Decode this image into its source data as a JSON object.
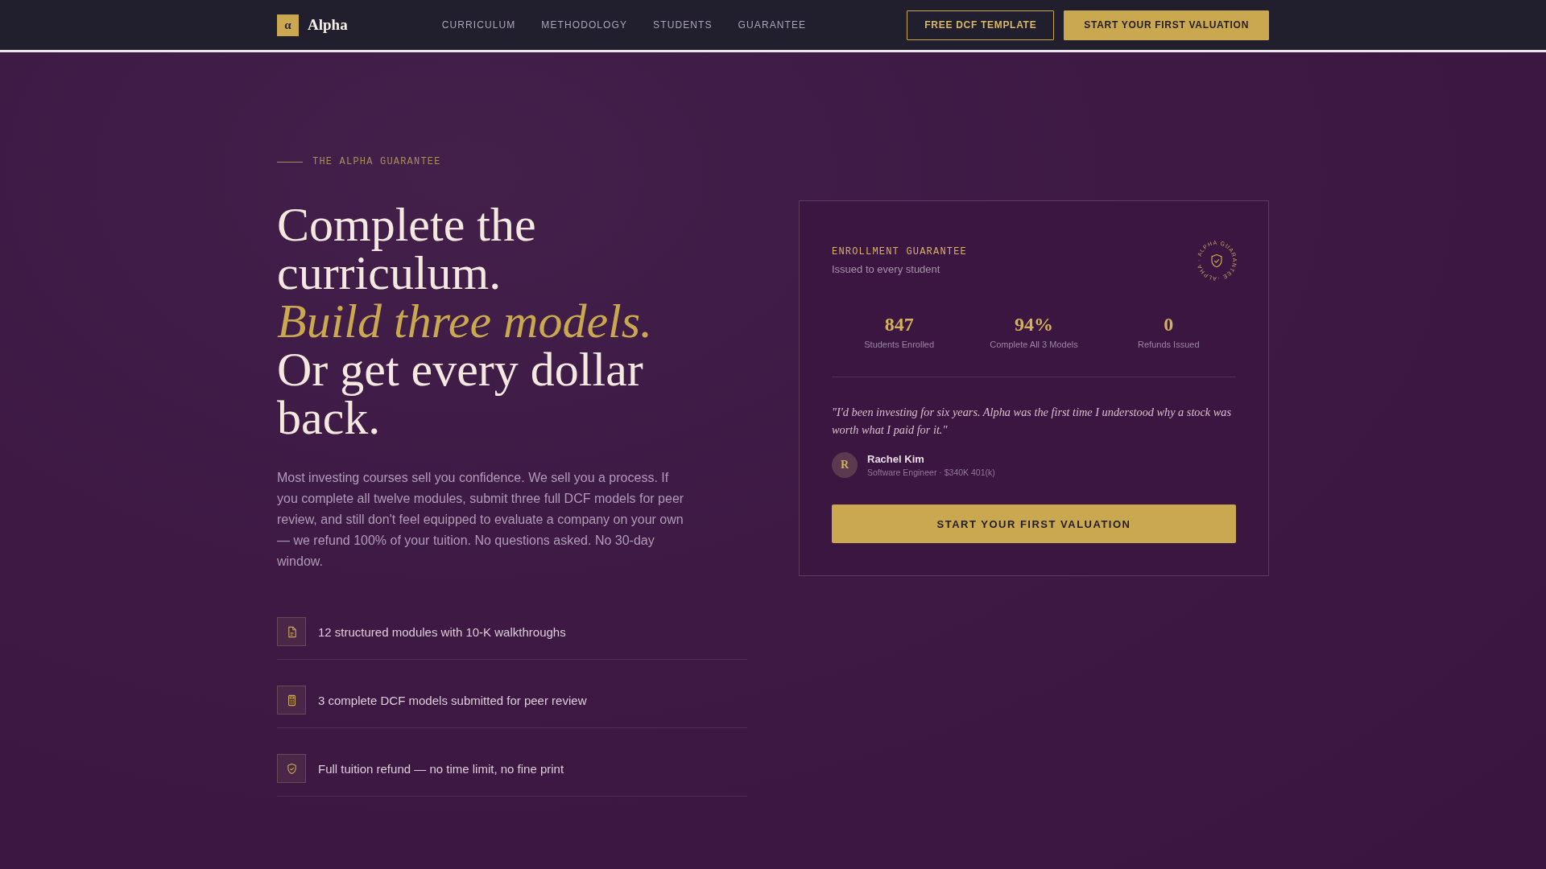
{
  "nav": {
    "logo": {
      "mark": "α",
      "name": "Alpha"
    },
    "links": [
      {
        "label": "CURRICULUM"
      },
      {
        "label": "METHODOLOGY"
      },
      {
        "label": "STUDENTS"
      },
      {
        "label": "GUARANTEE"
      }
    ],
    "buttons": [
      {
        "label": "FREE DCF TEMPLATE",
        "kind": "outline"
      },
      {
        "label": "START YOUR FIRST VALUATION",
        "kind": "solid"
      }
    ]
  },
  "hero": {
    "eyebrow": "THE ALPHA GUARANTEE",
    "headline": [
      {
        "text": "Complete the curriculum.",
        "kind": "plain"
      },
      {
        "text": "Build three models.",
        "kind": "accent"
      },
      {
        "text": "Or get every dollar back.",
        "kind": "plain"
      }
    ],
    "body": "Most investing courses sell you confidence. We sell you a process. If you complete all twelve modules, submit three full DCF models for peer review, and still don't feel equipped to evaluate a company on your own — we refund 100% of your tuition. No questions asked. No 30-day window.",
    "features": [
      {
        "text": "12 structured modules with 10-K walkthroughs",
        "kind": "document"
      },
      {
        "text": "3 complete DCF models submitted for peer review",
        "kind": "calculator"
      },
      {
        "text": "Full tuition refund — no time limit, no fine print",
        "kind": "shield"
      }
    ]
  },
  "card": {
    "eyebrow": "ENROLLMENT GUARANTEE",
    "subtitle": "Issued to every student",
    "seal": {
      "ring_text": "ALPHA · ALPHA GUARANTEE ·"
    },
    "stats": [
      {
        "value": "847",
        "label": "Students Enrolled"
      },
      {
        "value": "94%",
        "label": "Complete All 3 Models"
      },
      {
        "value": "0",
        "label": "Refunds Issued"
      }
    ],
    "quote": "\"I'd been investing for six years. Alpha was the first time I understood why a stock was worth what I paid for it.\"",
    "author": {
      "initial": "R",
      "name": "Rachel Kim",
      "role": "Software Engineer · $340K 401(k)"
    },
    "button": "START YOUR FIRST VALUATION"
  }
}
